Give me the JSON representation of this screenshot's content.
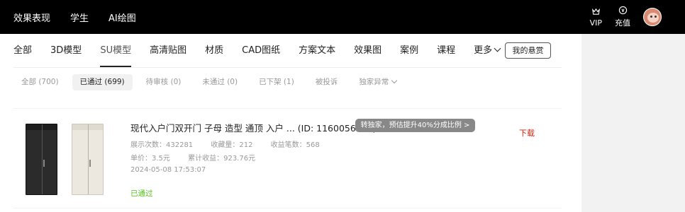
{
  "topnav": {
    "items": [
      "效果表现",
      "学生",
      "AI绘图"
    ]
  },
  "topright": {
    "vip_label": "VIP",
    "recharge_label": "充值"
  },
  "categories": {
    "items": [
      "全部",
      "3D模型",
      "SU模型",
      "高清贴图",
      "材质",
      "CAD图纸",
      "方案文本",
      "效果图",
      "案例",
      "课程",
      "更多"
    ],
    "active": "SU模型",
    "bounty_label": "我的悬赏"
  },
  "filters": {
    "items": [
      "全部 (700)",
      "已通过 (699)",
      "待审核 (0)",
      "未通过 (0)",
      "已下架 (1)",
      "被投诉",
      "独家异常"
    ],
    "selected": "已通过 (699)"
  },
  "item": {
    "title": "现代入户门双开门 子母 造型 通顶 入户 ...  (ID: 1160056393)",
    "badge": "转独家，预估提升40%分成比例 >",
    "views_label": "展示次数：432281",
    "favorites_label": "收藏量：212",
    "earnings_count_label": "收益笔数：568",
    "price_label": "单价：3.5元",
    "total_label": "累计收益：923.76元",
    "date": "2024-05-08 17:53:07",
    "status": "已通过",
    "download_label": "下载"
  },
  "colors": {
    "topbar": "#000000",
    "status_green": "#52c41a",
    "download_red": "#d81e06",
    "badge_gray": "#888888"
  }
}
